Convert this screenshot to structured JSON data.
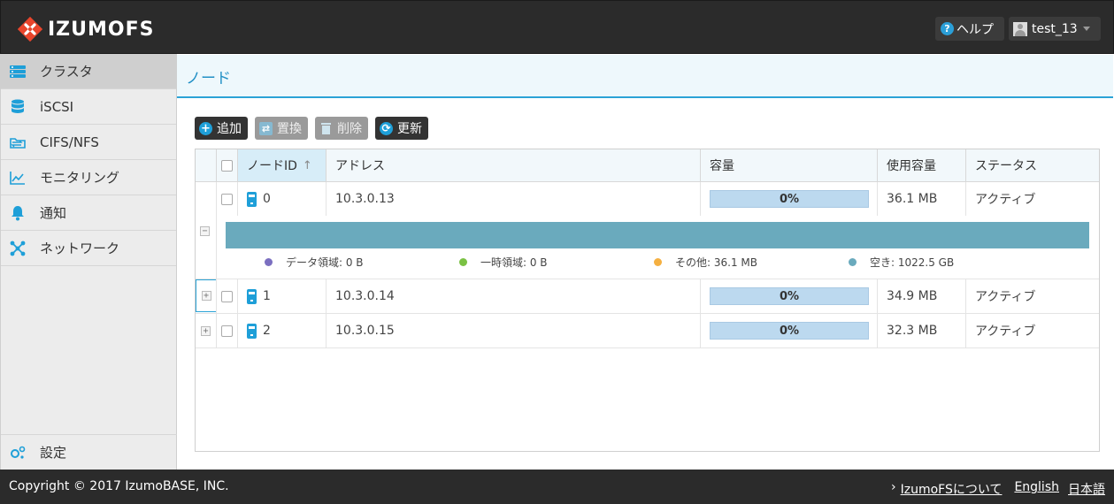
{
  "header": {
    "logo_text": "IZUMOFS",
    "help_label": "ヘルプ",
    "user_name": "test_13"
  },
  "sidebar": {
    "items": [
      {
        "label": "クラスタ",
        "icon": "server-icon",
        "active": true
      },
      {
        "label": "iSCSI",
        "icon": "database-icon"
      },
      {
        "label": "CIFS/NFS",
        "icon": "folder-share-icon"
      },
      {
        "label": "モニタリング",
        "icon": "chart-line-icon"
      },
      {
        "label": "通知",
        "icon": "bell-icon"
      },
      {
        "label": "ネットワーク",
        "icon": "network-icon"
      }
    ],
    "settings_label": "設定"
  },
  "page": {
    "title": "ノード"
  },
  "toolbar": {
    "add_label": "追加",
    "replace_label": "置換",
    "delete_label": "削除",
    "refresh_label": "更新"
  },
  "table": {
    "columns": [
      "ノードID",
      "アドレス",
      "容量",
      "使用容量",
      "ステータス"
    ],
    "rows": [
      {
        "id": "0",
        "address": "10.3.0.13",
        "capacity_pct": "0%",
        "used": "36.1 MB",
        "status": "アクティブ",
        "expanded": true
      },
      {
        "id": "1",
        "address": "10.3.0.14",
        "capacity_pct": "0%",
        "used": "34.9 MB",
        "status": "アクティブ"
      },
      {
        "id": "2",
        "address": "10.3.0.15",
        "capacity_pct": "0%",
        "used": "32.3 MB",
        "status": "アクティブ"
      }
    ],
    "detail_legend": [
      {
        "label": "データ領域: 0 B",
        "color": "#7b6fc0"
      },
      {
        "label": "一時領域: 0 B",
        "color": "#7ac143"
      },
      {
        "label": "その他: 36.1 MB",
        "color": "#f5b041"
      },
      {
        "label": "空き: 1022.5 GB",
        "color": "#6aaabd"
      }
    ]
  },
  "footer": {
    "copyright": "Copyright © 2017 IzumoBASE, INC.",
    "about_link": "IzumoFSについて",
    "english_link": "English",
    "japanese_link": "日本語"
  }
}
